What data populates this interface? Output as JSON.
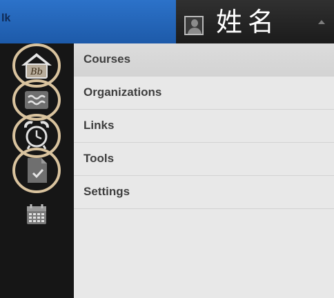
{
  "topbar": {
    "left_text": "lk",
    "user_name": "姓名",
    "icons": {
      "avatar": "user-avatar-icon",
      "caret": "caret-up-icon"
    }
  },
  "rail": {
    "items": [
      {
        "name": "home-icon",
        "label": "Bb",
        "highlighted": true
      },
      {
        "name": "streams-icon",
        "highlighted": true
      },
      {
        "name": "alarm-clock-icon",
        "highlighted": true
      },
      {
        "name": "grades-icon",
        "highlighted": true
      },
      {
        "name": "calendar-icon",
        "highlighted": false
      }
    ],
    "highlight_color": "#d9c39e"
  },
  "menu": {
    "items": [
      {
        "label": "Courses",
        "active": true
      },
      {
        "label": "Organizations",
        "active": false
      },
      {
        "label": "Links",
        "active": false
      },
      {
        "label": "Tools",
        "active": false
      },
      {
        "label": "Settings",
        "active": false
      }
    ]
  },
  "colors": {
    "topbar_blue": "#2065b8",
    "user_menu_dark": "#252525",
    "rail_bg": "#161616",
    "menu_bg": "#e8e8e8"
  }
}
